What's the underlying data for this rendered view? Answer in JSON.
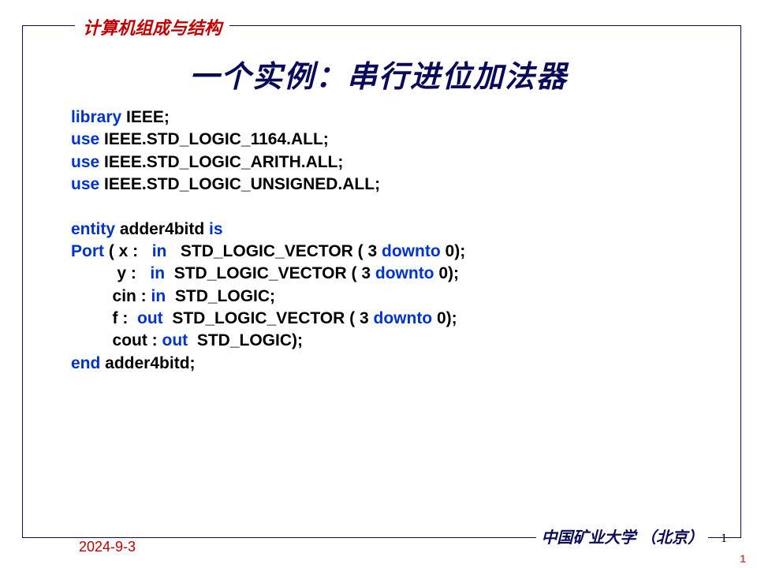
{
  "header": "计算机组成与结构",
  "title": "一个实例：串行进位加法器",
  "code": {
    "l1a": "library ",
    "l1b": "IEEE;",
    "l2a": "use ",
    "l2b": "IEEE.STD_LOGIC_1164.ALL;",
    "l3a": "use ",
    "l3b": "IEEE.STD_LOGIC_ARITH.ALL;",
    "l4a": "use ",
    "l4b": "IEEE.STD_LOGIC_UNSIGNED.ALL;",
    "l5": " ",
    "l6a": "entity ",
    "l6b": "adder4bitd ",
    "l6c": "is",
    "l7a": "Port ",
    "l7b": "( x :   ",
    "l7c": "in   ",
    "l7d": "STD_LOGIC_VECTOR ( 3 ",
    "l7e": "downto ",
    "l7f": "0);",
    "l8a": "          y :   ",
    "l8b": "in  ",
    "l8c": "STD_LOGIC_VECTOR ( 3 ",
    "l8d": "downto ",
    "l8e": "0);",
    "l9a": "         cin : ",
    "l9b": "in  ",
    "l9c": "STD_LOGIC;",
    "l10a": "         f :  ",
    "l10b": "out  ",
    "l10c": "STD_LOGIC_VECTOR ( 3 ",
    "l10d": "downto ",
    "l10e": "0);",
    "l11a": "         cout : ",
    "l11b": "out  ",
    "l11c": "STD_LOGIC);",
    "l12a": "end ",
    "l12b": "adder4bitd;"
  },
  "footer": {
    "university": "中国矿业大学 （北京）",
    "date": "2024-9-3",
    "page_inner": "1",
    "page_outer": "1"
  }
}
